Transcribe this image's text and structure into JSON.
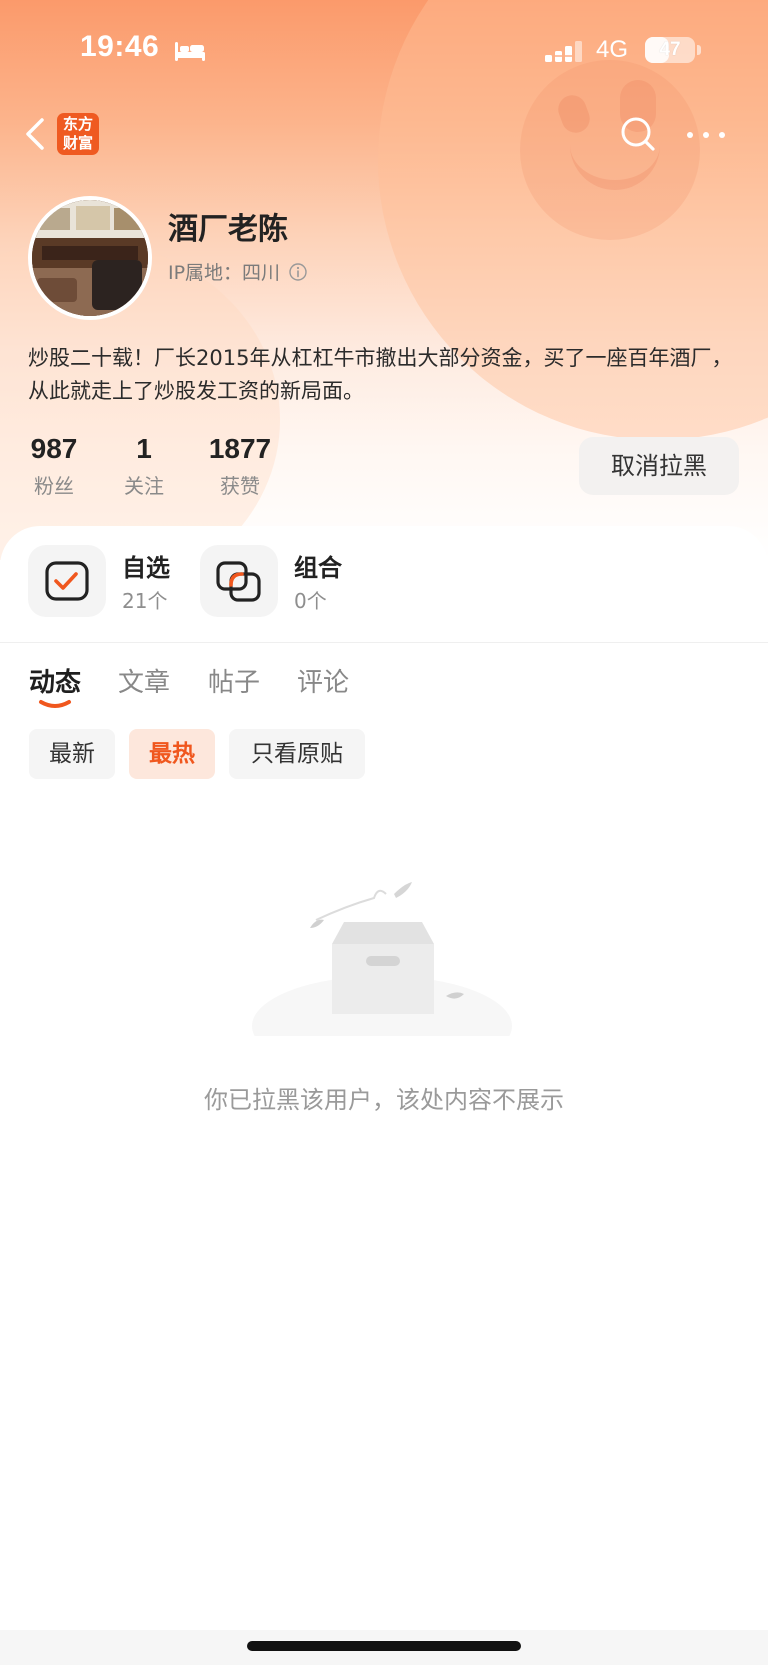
{
  "status_bar": {
    "time": "19:46",
    "network": "4G",
    "battery": "47",
    "battery_level": 0.47
  },
  "nav": {
    "back_icon": "chevron-left-icon",
    "logo_text_line1": "东方",
    "logo_text_line2": "财富",
    "search_icon": "search-icon",
    "more_icon": "more-dots-icon"
  },
  "profile": {
    "name": "酒厂老陈",
    "ip_label": "IP属地：四川",
    "bio": "炒股二十载！厂长2015年从杠杠牛市撤出大部分资金，买了一座百年酒厂，从此就走上了炒股发工资的新局面。",
    "stats": [
      {
        "num": "987",
        "label": "粉丝"
      },
      {
        "num": "1",
        "label": "关注"
      },
      {
        "num": "1877",
        "label": "获赞"
      }
    ],
    "unblock_label": "取消拉黑"
  },
  "shortcuts": [
    {
      "title": "自选",
      "count": "21个",
      "icon": "watchlist-check-icon"
    },
    {
      "title": "组合",
      "count": "0个",
      "icon": "portfolio-icon"
    }
  ],
  "tabs": [
    "动态",
    "文章",
    "帖子",
    "评论"
  ],
  "active_tab": "动态",
  "filters": [
    "最新",
    "最热",
    "只看原贴"
  ],
  "active_filter": "最热",
  "empty_state": {
    "illustration": "empty-box-icon",
    "message": "你已拉黑该用户，该处内容不展示"
  },
  "colors": {
    "accent": "#f0571e",
    "logo_bg": "#ef5a21",
    "header_gradient_top": "#fb9a6b"
  }
}
